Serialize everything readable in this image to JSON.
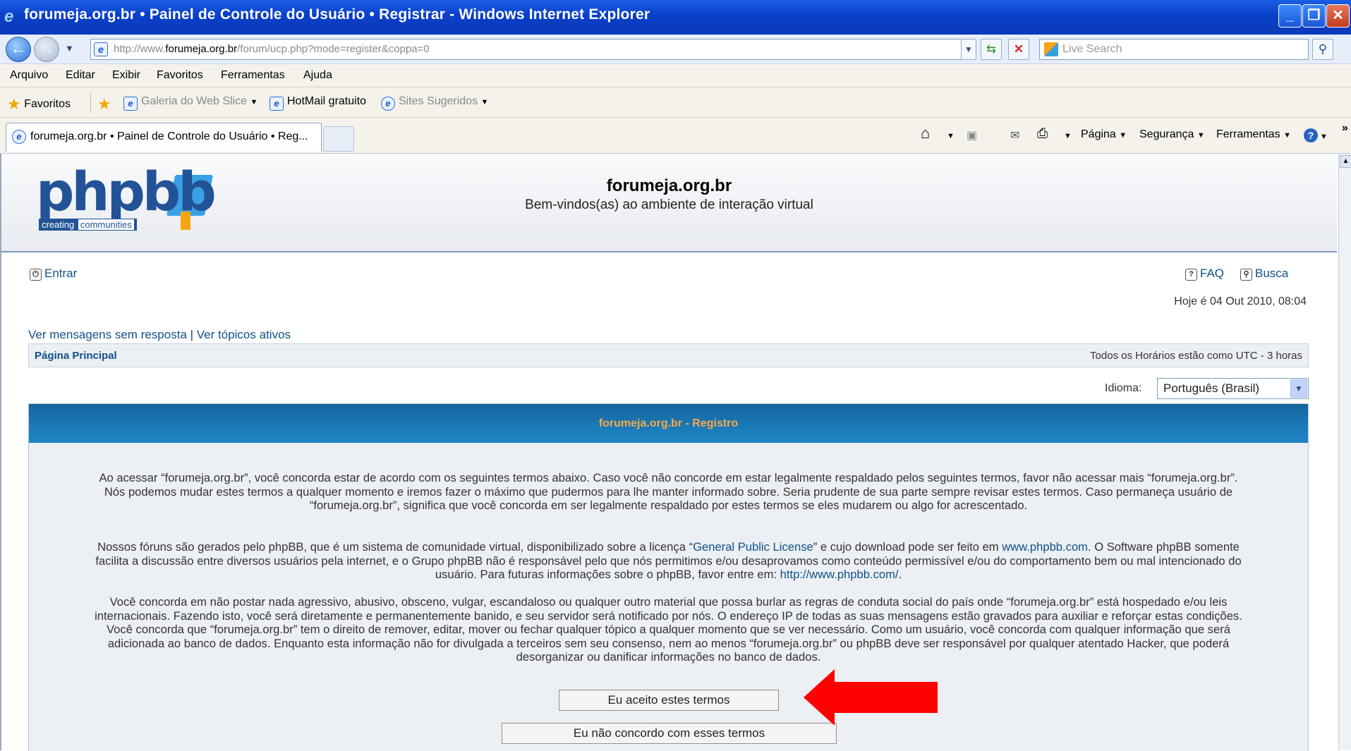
{
  "window": {
    "title": "forumeja.org.br • Painel de Controle do Usuário • Registrar - Windows Internet Explorer",
    "buttons": {
      "minimize": "_",
      "maximize": "❐",
      "close": "✕"
    }
  },
  "addressbar": {
    "url_prefix": "http://www.",
    "url_domain": "forumeja.org.br",
    "url_path": "/forum/ucp.php?mode=register&coppa=0",
    "search_placeholder": "Live Search"
  },
  "menubar": [
    "Arquivo",
    "Editar",
    "Exibir",
    "Favoritos",
    "Ferramentas",
    "Ajuda"
  ],
  "favorites": {
    "favoritos": "Favoritos",
    "galeria": "Galeria do Web Slice",
    "hotmail": "HotMail gratuito",
    "sites": "Sites Sugeridos"
  },
  "tabs": {
    "active": "forumeja.org.br • Painel de Controle do Usuário • Reg..."
  },
  "commandbar": {
    "pagina": "Página",
    "seguranca": "Segurança",
    "ferramentas": "Ferramentas",
    "more": "»"
  },
  "site": {
    "logo_text": "phpbb",
    "logo_tagline_1": "creating",
    "logo_tagline_2": "communities",
    "title": "forumeja.org.br",
    "description": "Bem-vindos(as) ao ambiente de interação virtual",
    "login": "Entrar",
    "faq": "FAQ",
    "busca": "Busca",
    "today": "Hoje é 04 Out 2010, 08:04",
    "link_unanswered": "Ver mensagens sem resposta",
    "link_separator": " | ",
    "link_active": "Ver tópicos ativos",
    "breadcrumb_home": "Página Principal",
    "timezone": "Todos os Horários estão como UTC - 3 horas",
    "language_label": "Idioma:",
    "language_value": "Português (Brasil)"
  },
  "panel": {
    "heading": "forumeja.org.br - Registro",
    "paragraph1": "Ao acessar “forumeja.org.br”, você concorda estar de acordo com os seguintes termos abaixo. Caso você não concorde em estar legalmente respaldado pelos seguintes termos, favor não acessar mais “forumeja.org.br”. Nós podemos mudar estes termos a qualquer momento e iremos fazer o máximo que pudermos para lhe manter informado sobre. Seria prudente de sua parte sempre revisar estes termos. Caso permaneça usuário de “forumeja.org.br”, significa que você concorda em ser legalmente respaldado por estes termos se eles mudarem ou algo for acrescentado.",
    "paragraph2_a": "Nossos fóruns são gerados pelo phpBB, que é um sistema de comunidade virtual, disponibilizado sobre a licença “",
    "paragraph2_license": "General Public License",
    "paragraph2_b": "” e cujo download pode ser feito em ",
    "paragraph2_site": "www.phpbb.com",
    "paragraph2_c": ". O Software phpBB somente facilita a discussão entre diversos usuários pela internet, e o Grupo phpBB não é responsável pelo que nós permitimos e/ou desaprovamos como conteúdo permissível e/ou do comportamento bem ou mal intencionado do usuário. Para futuras informações sobre o phpBB, favor entre em: ",
    "paragraph2_url": "http://www.phpbb.com/",
    "paragraph2_d": ".",
    "paragraph3": "Você concorda em não postar nada agressivo, abusivo, obsceno, vulgar, escandaloso ou qualquer outro material que possa burlar as regras de conduta social do país onde “forumeja.org.br” está hospedado e/ou leis internacionais. Fazendo isto, você será diretamente e permanentemente banido, e seu servidor será notificado por nós. O endereço IP de todas as suas mensagens estão gravados para auxiliar e reforçar estas condições. Você concorda que “forumeja.org.br” tem o direito de remover, editar, mover ou fechar qualquer tópico a qualquer momento que se ver necessário. Como um usuário, você concorda com qualquer informação que será adicionada ao banco de dados. Enquanto esta informação não for divulgada a terceiros sem seu consenso, nem ao menos “forumeja.org.br” ou phpBB deve ser responsável por qualquer atentado Hacker, que poderá desorganizar ou danificar informações no banco de dados.",
    "accept_button": "Eu aceito estes termos",
    "decline_button": "Eu não concordo com esses termos"
  },
  "colors": {
    "title_bar": "#0a3fc8",
    "panel_header": "#1a7ab8",
    "panel_header_text": "#f7a84b",
    "link": "#105289",
    "annotation_arrow": "#ff0000"
  }
}
